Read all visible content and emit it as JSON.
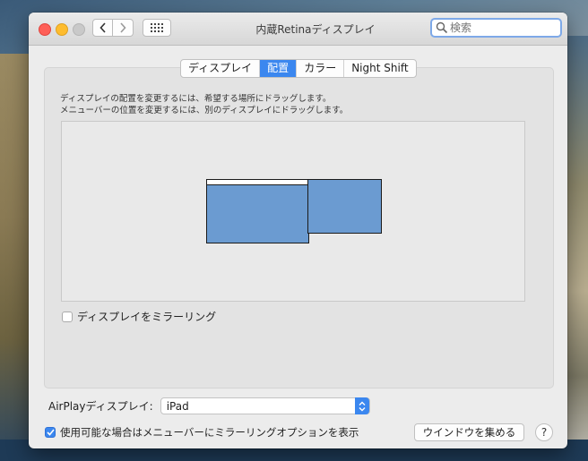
{
  "window": {
    "title": "内蔵Retinaディスプレイ"
  },
  "toolbar": {
    "search_placeholder": "検索",
    "back_icon": "chevron-left-icon",
    "forward_icon": "chevron-right-icon",
    "grid_icon": "grid-icon"
  },
  "tabs": [
    {
      "label": "ディスプレイ",
      "active": false
    },
    {
      "label": "配置",
      "active": true
    },
    {
      "label": "カラー",
      "active": false
    },
    {
      "label": "Night Shift",
      "active": false
    }
  ],
  "arrangement": {
    "instruction_line1": "ディスプレイの配置を変更するには、希望する場所にドラッグします。",
    "instruction_line2": "メニューバーの位置を変更するには、別のディスプレイにドラッグします。"
  },
  "mirror": {
    "label": "ディスプレイをミラーリング",
    "checked": false
  },
  "airplay": {
    "label": "AirPlayディスプレイ:",
    "selected": "iPad"
  },
  "menu_option": {
    "label": "使用可能な場合はメニューバーにミラーリングオプションを表示",
    "checked": true
  },
  "buttons": {
    "gather": "ウインドウを集める",
    "help": "?"
  },
  "colors": {
    "accent": "#3b87ef",
    "display_fill": "#6b9bd1"
  }
}
